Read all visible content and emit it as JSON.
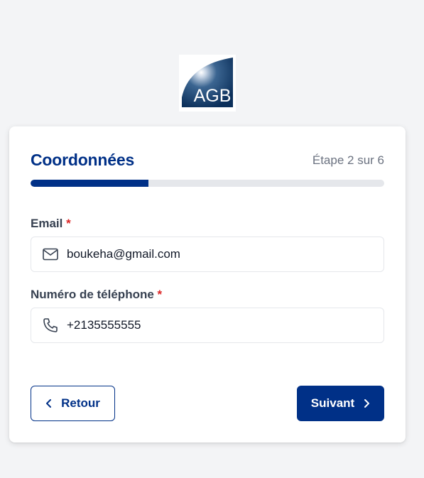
{
  "logo": {
    "text": "AGB"
  },
  "form": {
    "title": "Coordonnées",
    "step_text": "Étape 2 sur 6",
    "progress_fraction": 0.333,
    "email": {
      "label": "Email",
      "required_mark": "*",
      "value": "boukeha@gmail.com",
      "icon": "mail-icon"
    },
    "phone": {
      "label": "Numéro de téléphone",
      "required_mark": "*",
      "value": "+2135555555",
      "icon": "phone-icon"
    },
    "back_label": "Retour",
    "next_label": "Suivant"
  },
  "colors": {
    "brand": "#003087",
    "required": "#dc2626",
    "background": "#f3f4f6"
  }
}
